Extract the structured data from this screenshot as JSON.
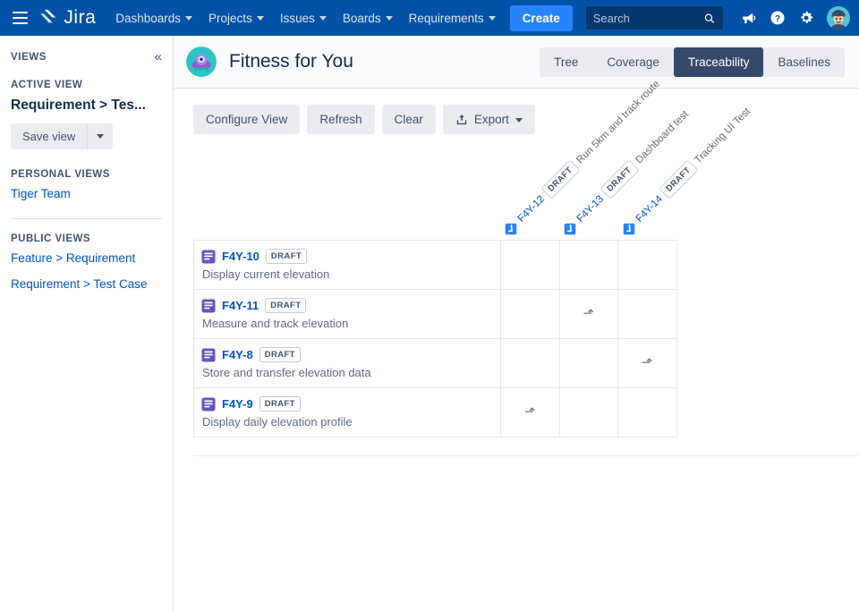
{
  "topnav": {
    "menu_icon": "hamburger-icon",
    "brand": "Jira",
    "items": [
      {
        "label": "Dashboards",
        "has_caret": true
      },
      {
        "label": "Projects",
        "has_caret": true
      },
      {
        "label": "Issues",
        "has_caret": true
      },
      {
        "label": "Boards",
        "has_caret": true
      },
      {
        "label": "Requirements",
        "has_caret": true
      }
    ],
    "create_label": "Create",
    "search_placeholder": "Search",
    "search_value": "",
    "icons": [
      "search-icon",
      "megaphone-icon",
      "help-icon",
      "settings-gear-icon",
      "user-avatar"
    ]
  },
  "sidebar": {
    "title": "VIEWS",
    "collapse_icon": "«",
    "active_view_label": "ACTIVE VIEW",
    "active_view_name": "Requirement > Tes...",
    "save_view_label": "Save view",
    "personal_views_label": "PERSONAL VIEWS",
    "personal_views": [
      {
        "label": "Tiger Team"
      }
    ],
    "public_views_label": "PUBLIC VIEWS",
    "public_views": [
      {
        "label": "Feature > Requirement"
      },
      {
        "label": "Requirement > Test Case"
      }
    ]
  },
  "page": {
    "project_avatar": "project-avatar-icon",
    "title": "Fitness for You",
    "tabs": [
      {
        "label": "Tree",
        "active": false
      },
      {
        "label": "Coverage",
        "active": false
      },
      {
        "label": "Traceability",
        "active": true
      },
      {
        "label": "Baselines",
        "active": false
      }
    ],
    "toolbar": [
      {
        "label": "Configure View",
        "icon": null,
        "caret": false
      },
      {
        "label": "Refresh",
        "icon": null,
        "caret": false
      },
      {
        "label": "Clear",
        "icon": null,
        "caret": false
      },
      {
        "label": "Export",
        "icon": "export-upload-icon",
        "caret": true
      }
    ]
  },
  "matrix": {
    "columns": [
      {
        "key": "F4Y-12",
        "status": "DRAFT",
        "summary": "Run 5km and track route",
        "icon": "test-case-icon"
      },
      {
        "key": "F4Y-13",
        "status": "DRAFT",
        "summary": "Dashboard test",
        "icon": "test-case-icon"
      },
      {
        "key": "F4Y-14",
        "status": "DRAFT",
        "summary": "Tracking UI Test",
        "icon": "test-case-icon"
      }
    ],
    "rows": [
      {
        "key": "F4Y-10",
        "status": "DRAFT",
        "summary": "Display current elevation",
        "icon": "requirement-icon",
        "links": [
          false,
          false,
          false
        ]
      },
      {
        "key": "F4Y-11",
        "status": "DRAFT",
        "summary": "Measure and track elevation",
        "icon": "requirement-icon",
        "links": [
          false,
          true,
          false
        ]
      },
      {
        "key": "F4Y-8",
        "status": "DRAFT",
        "summary": "Store and transfer elevation data",
        "icon": "requirement-icon",
        "links": [
          false,
          false,
          true
        ]
      },
      {
        "key": "F4Y-9",
        "status": "DRAFT",
        "summary": "Display daily elevation profile",
        "icon": "requirement-icon",
        "links": [
          true,
          false,
          false
        ]
      }
    ],
    "link_glyph": "⬏"
  },
  "colors": {
    "nav_bg": "#0052a8",
    "link": "#0052cc",
    "create_btn": "#2684ff",
    "active_tab": "#354a6b",
    "requirement_icon": "#6554c0",
    "test_case_icon": "#2684ff"
  }
}
